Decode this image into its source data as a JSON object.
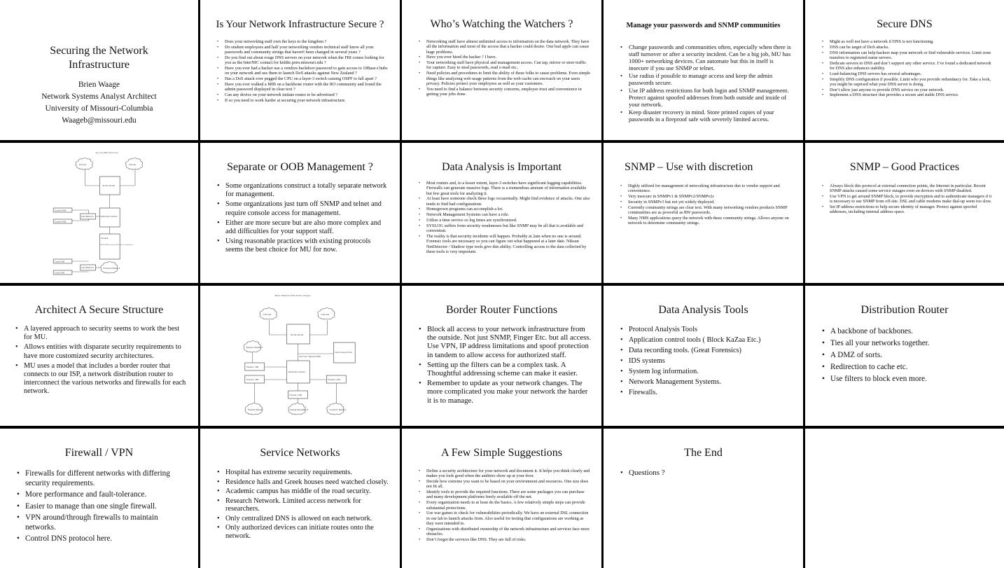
{
  "deck_title": "Securing the Network Infrastructure",
  "slides": [
    {
      "title": "Securing the Network Infrastructure",
      "author": "Brien Waage",
      "role": "Network Systems Analyst Architect",
      "organization": "University of Missouri-Columbia",
      "email": "Waageb@missouri.edu"
    },
    {
      "title": "Is Your Network Infrastructure Secure ?",
      "bullets": [
        "Does your networking staff own the keys to the kingdom ?",
        "Do student employees and half your networking vendors technical staff know all your passwords and community strings that haven't been changed in several years ?",
        "Do you find out about rouge DNS servers on your network when the FBI comes looking for you as the InterNIC contact for kiddie.porn.missouri.edu ?",
        "Have you ever had a hacker use a vendors backdoor password to gain access to 10Base-t hubs on your network  and use them to launch DoS attacks against New Zealand ?",
        "Has a DoS attack ever pegged the CPU on a layer-3 switch causing OSPF to fall apart ?",
        "Have you ever walked a MIB on a backbone router with the RO community and found the admin password displayed in clear text ?",
        "Can any device on your network initiate routes to be advertised ?",
        "If so you need to work harder at securing your network infrastructure."
      ]
    },
    {
      "title": "Who’s Watching the Watchers ?",
      "bullets": [
        "Networking staff have almost unlimited access to information on the data network. They have all the information and most of the access that a hacker could desire. One bad apple can cause huge problems.",
        "Have you ever hired the hacker ? I have.",
        "Your networking staff have physical and management access. Can tap, mirror or steer traffic for capture. Easy to steal passwords, read e-mail etc..",
        "Need policies and procedures to limit the ability of these folks to cause problems. Even simple things like analyzing web usage patterns from the web cache can encroach on your users privacy. Policies protect your employees as well as your customers.",
        "You need to find a balance between security concerns, employee trust and convenience in getting your jobs done."
      ]
    },
    {
      "title": "Manage your passwords and SNMP communities",
      "bullets": [
        "Change passwords and communities often, especially when there is staff turnover or after a security incident. Can be a big job, MU has 1000+ networking devices. Can automate but this in itself is insecure if you use SNMP or telnet.",
        "Use radius if possible to manage access and keep the admin passwords secure.",
        "Use IP address restrictions for both login and SNMP management. Protect against spoofed addresses from both outside and inside of your network.",
        "Keep disaster recovery in mind. Store printed copies of your passwords in a fireproof safe with severely limited access."
      ]
    },
    {
      "title": "Secure DNS",
      "bullets": [
        "Might as well not have a network if DNS is not functioning.",
        "DNS can be target of DoS attacks.",
        "DNS information can help hackers map your network or find vulnerable services. Limit zone transfers to registered name servers.",
        "Dedicate servers to DNS and don’t support any other service. I’ve found a dedicated network for DNS also enhances stability.",
        "Load-balancing DNS servers has several advantages.",
        "Simplify DNS configuration if possible. Limit who you provide redundancy for. Take a look, you might be suprised what your DNS server is doing.",
        "Don’t allow just anyone to provide DNS service on your network.",
        "Implement a DNS structure that provides a secure and stable DNS service."
      ]
    },
    {
      "diagram_title": "Secure DNS Structure",
      "nodes": {
        "isp1": "Internet",
        "isp2": "Internet",
        "border": "Border Router",
        "outside_dns_1": "Outside DNS",
        "outside_dns_2": "Outside DNS",
        "lb_outer": "Load Balancer",
        "distribution": "Distribution Router",
        "firewall": "Firewall",
        "firewall_note": "Blocks DNS except the NetCheck to authorized",
        "inside_dns_1": "Inside DNS",
        "inside_dns_2": "Inside DNS",
        "lb_inner": "Load Balancer",
        "protected_net": "Protected Network"
      }
    },
    {
      "title": "Separate or OOB Management ?",
      "bullets": [
        "Some organizations construct a totally separate network for management.",
        "Some organizations just turn off SNMP and telnet and require console access for management.",
        "Either are more secure but are also more complex and add difficulties for your support staff.",
        "Using reasonable practices with existing protocols seems the best choice for MU for now."
      ]
    },
    {
      "title": "Data Analysis is Important",
      "bullets": [
        "Most routers and, to a lesser extent, layer-3 switches have significant logging capabilities. Firewalls can generate massive logs. There is a tremendous amount of information available but few great tools for analyzing it.",
        "At least have someone check these logs occasionally. Might find evidence of attacks. One also tends to find bad configurations",
        "Homegrown programs can accomplish a lot.",
        "Network Management Systems can have a role.",
        "Utilize a time service so log times are synchronized.",
        "SYSLOG suffers from security weaknesses but like SNMP may be all that is available and convenient.",
        "The reality is that security incidents will happen. Probably at 2am when no one is around. Forensic tools are necessary so you can figure out what happened at a later date. Niksun NetDetector / Shadow type tools give this ability. Controlling access to the data collected by these tools is very important."
      ]
    },
    {
      "title": "SNMP – Use with discretion",
      "bullets": [
        "Highly utilized for management of networking infrastructure due to vendor support and convenience.",
        "Very insecure in SNMPv1 & SNMPv2/SNMPv2c",
        "Security in SNMPv3 but not yet widely deployed.",
        "Currently community strings are clear text. With many networking vendors products SNMP communities are as powerful as RW passwords.",
        "Many NMS applications query the network with these community strings. Allows anyone on network to determine community strings."
      ]
    },
    {
      "title": "SNMP – Good Practices",
      "bullets": [
        "Always block this protocol at external connection points, the Internet in particular. Recent SNMP attacks caused some service outages even on devices with SNMP disabled.",
        "Use VPN to get around SNMP block, to provide encryption and to authenticate managers if it is necessary to use SNMP from off-site. DSL and cable modems make dial-up seem too slow.",
        "Set IP address restrictions to help secure identity of manager. Protect against spoofed addresses, including internal address space."
      ]
    },
    {
      "title": "Architect A Secure Structure",
      "bullets": [
        "A layered  approach to security seems to work the best for MU.",
        "Allows entities with disparate security requirements to have more customized security architectures.",
        "MU uses a model that includes a border router that connects to our ISP, a network distribution router to interconnect the various networks and firewalls for each network."
      ]
    },
    {
      "diagram_title": "Basic Network Distribution Design",
      "nodes": {
        "isp1": "Internet1",
        "isp2": "Internet2",
        "border": "Border Router",
        "data_tools": "Data Analysis Tools",
        "mirror": "Mirrored / Tapped Traffic",
        "research": "Research Network",
        "fw_research": "Firewall / VPN",
        "fw_hospital": "Firewall / VPN",
        "distribution": "Distribution Router",
        "fw_residential": "Firewall / VPN",
        "fw_academic": "Firewall / VPN",
        "hospital": "Hospital Network",
        "residential": "Residential Network",
        "academic": "Academic Network"
      }
    },
    {
      "title": "Border Router Functions",
      "bullets": [
        "Block all access to your network infrastructure from the outside. Not just SNMP, Finger Etc. but all access. Use VPN, IP address limitations and spoof protection in tandem to allow access for authorized staff.",
        "Setting up the filters can be a complex task. A Thoughtful addressing scheme can make it easier.",
        "Remember to update as your network changes. The more complicated you make your network the harder it is to manage."
      ]
    },
    {
      "title": "Data Analysis Tools",
      "bullets": [
        "Protocol Analysis Tools",
        "Application control tools ( Block KaZaa Etc.)",
        "Data recording tools. (Great Forensics)",
        "IDS systems",
        "System log information.",
        "Network Management Systems.",
        "Firewalls."
      ]
    },
    {
      "title": "Distribution Router",
      "bullets": [
        "A backbone of backbones.",
        "Ties all your networks together.",
        "A DMZ of sorts.",
        "Redirection to cache etc.",
        "Use filters to block even more."
      ]
    },
    {
      "title": "Firewall / VPN",
      "bullets": [
        "Firewalls for different networks with differing security requirements.",
        "More performance and fault-tolerance.",
        "Easier to manage than one single firewall.",
        "VPN around/through firewalls to maintain networks.",
        "Control DNS protocol here."
      ]
    },
    {
      "title": "Service Networks",
      "bullets": [
        "Hospital has extreme security requirements.",
        "Residence halls and Greek houses need watched closely.",
        "Academic campus has middle of the road security.",
        "Research Network. Limited access network for researchers.",
        "Only centralized DNS is allowed on each network.",
        "Only authorized devices can initiate routes onto the network."
      ]
    },
    {
      "title": "A Few Simple Suggestions",
      "bullets": [
        "Define a security architecture for your network and document it. It helps you think clearly and makes you look good when the auditors show up at your door.",
        "Decide how extreme you want to be based on your environment and resources.  One size does not fit all.",
        "Identify tools to provide the required functions. There are some packages you can purchase and many development platforms freely available off the net.",
        "Every organization needs to at least do the basics. A few relatively simple steps can provide substantial protections.",
        "Use war games to check for vulnerabilities periodically. We have an external DSL connection in our lab to launch attacks from. Also useful for testing that configurations are working as they were intended to.",
        "Organizations with distributed ownership of the network infrastructure and services face more obstacles.",
        "Don’t forget the services like DNS. They are full of risks."
      ]
    },
    {
      "title": "The End",
      "bullets": [
        "Questions ?"
      ]
    }
  ]
}
